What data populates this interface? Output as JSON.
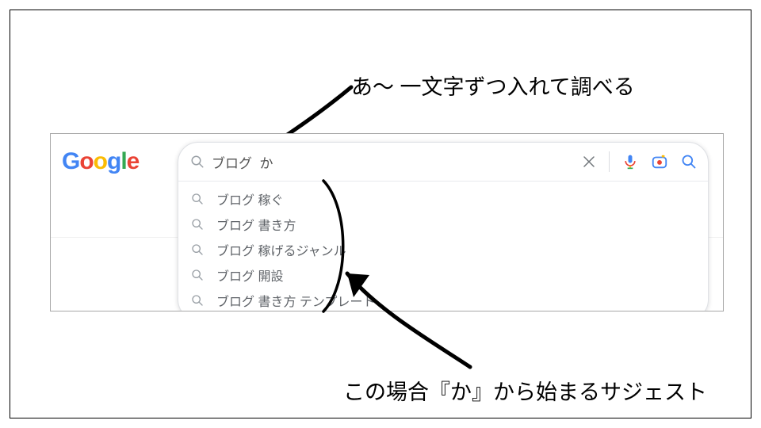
{
  "annotations": {
    "top": "あ～ 一文字ずつ入れて調べる",
    "bottom": "この場合『か』から始まるサジェスト"
  },
  "logo": {
    "g1": "G",
    "o1": "o",
    "o2": "o",
    "g2": "g",
    "l": "l",
    "e": "e"
  },
  "search": {
    "query": "ブログ  か",
    "suggestions": [
      "ブログ 稼ぐ",
      "ブログ 書き方",
      "ブログ 稼げるジャンル",
      "ブログ 開設",
      "ブログ 書き方 テンプレート"
    ]
  }
}
